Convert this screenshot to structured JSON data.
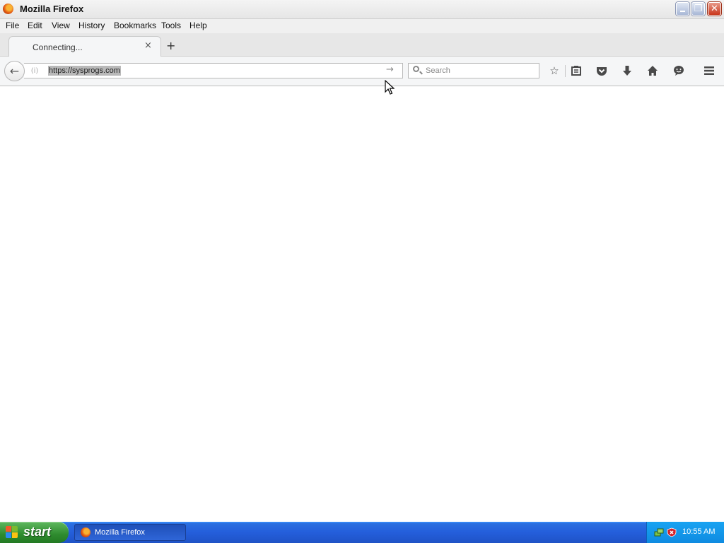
{
  "window": {
    "title": "Mozilla Firefox"
  },
  "menu": {
    "items": [
      "File",
      "Edit",
      "View",
      "History",
      "Bookmarks",
      "Tools",
      "Help"
    ]
  },
  "tabs": [
    {
      "label": "Connecting...",
      "close": "×"
    }
  ],
  "new_tab": "+",
  "navbar": {
    "url": "https://sysprogs.com",
    "search_placeholder": "Search",
    "icons": [
      "back-icon",
      "info-icon",
      "go-arrow-icon",
      "search-icon",
      "bookmark-star-icon",
      "reading-list-icon",
      "pocket-icon",
      "download-icon",
      "home-icon",
      "chat-icon",
      "menu-icon"
    ]
  },
  "taskbar": {
    "start_label": "start",
    "items": [
      {
        "label": "Mozilla Firefox"
      }
    ],
    "clock": "10:55 AM"
  },
  "colors": {
    "taskbar_blue": "#245edb",
    "start_green": "#2e8b2e",
    "tray_blue": "#0f8be1"
  }
}
